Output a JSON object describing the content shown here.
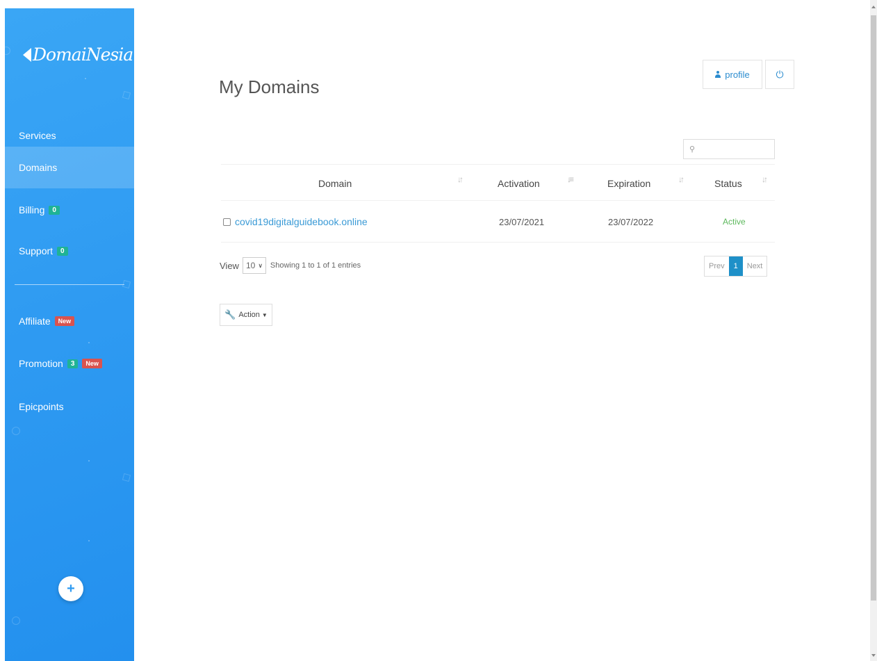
{
  "brand": {
    "logo_text": "DomaiNesia"
  },
  "sidebar": {
    "items": [
      {
        "label": "Services"
      },
      {
        "label": "Domains",
        "active": true
      },
      {
        "label": "Billing",
        "count": "0"
      },
      {
        "label": "Support",
        "count": "0"
      },
      {
        "label": "Affiliate",
        "new_badge": "New"
      },
      {
        "label": "Promotion",
        "count": "3",
        "new_badge": "New"
      },
      {
        "label": "Epicpoints"
      }
    ],
    "fab_icon": "+"
  },
  "header": {
    "profile_label": "profile",
    "power_icon": "⏻"
  },
  "page": {
    "title": "My Domains"
  },
  "search": {
    "placeholder": ""
  },
  "table": {
    "columns": [
      "Domain",
      "Activation",
      "Expiration",
      "Status"
    ],
    "rows": [
      {
        "domain": "covid19digitalguidebook.online",
        "activation": "23/07/2021",
        "expiration": "23/07/2022",
        "status": "Active"
      }
    ]
  },
  "footer": {
    "view_label": "View",
    "page_size": "10",
    "showing": "Showing 1 to 1 of 1 entries",
    "prev": "Prev",
    "current_page": "1",
    "next": "Next",
    "action_label": "Action"
  },
  "colors": {
    "sidebar": "#2f9bf2",
    "link": "#3a9ad6",
    "active_status": "#5cb85c",
    "badge_count": "#1fb395",
    "badge_new": "#d9534f",
    "pager_current": "#1e90c8"
  }
}
